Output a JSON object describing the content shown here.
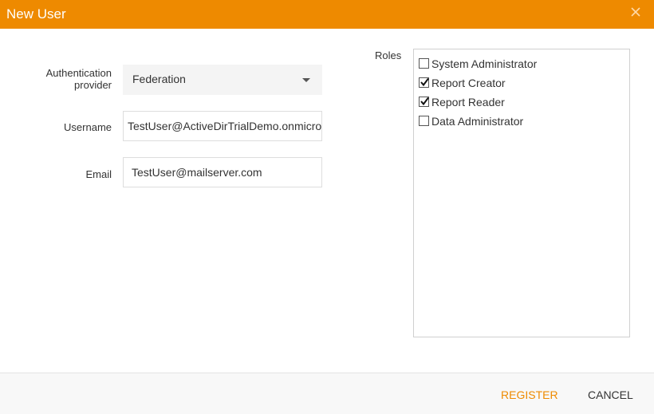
{
  "dialog": {
    "title": "New User",
    "close_icon": "close-icon",
    "accent_color": "#ee8a00"
  },
  "form": {
    "auth_provider_label_line1": "Authentication",
    "auth_provider_label_line2": "provider",
    "auth_provider_value": "Federation",
    "username_label": "Username",
    "username_value": "TestUser@ActiveDirTrialDemo.onmicrosoft.com",
    "email_label": "Email",
    "email_value": "TestUser@mailserver.com"
  },
  "roles": {
    "label": "Roles",
    "items": [
      {
        "label": "System Administrator",
        "checked": false
      },
      {
        "label": "Report Creator",
        "checked": true
      },
      {
        "label": "Report Reader",
        "checked": true
      },
      {
        "label": "Data Administrator",
        "checked": false
      }
    ]
  },
  "footer": {
    "register_label": "REGISTER",
    "cancel_label": "CANCEL"
  }
}
